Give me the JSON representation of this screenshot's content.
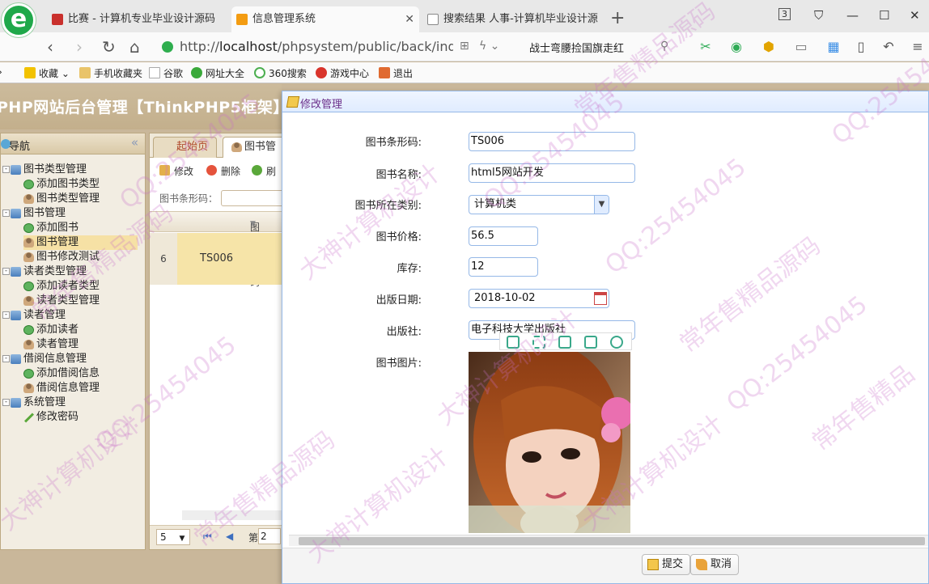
{
  "browser": {
    "tabs": [
      {
        "title": "比赛 - 计算机专业毕业设计源码",
        "icon_color": "#c9302c"
      },
      {
        "title": "信息管理系统",
        "icon_color": "#f39c12"
      },
      {
        "title": "搜索结果 人事-计算机毕业设计源",
        "icon_color": "#888888"
      }
    ],
    "tab_count_badge": "3",
    "url_prefix": "http://",
    "url_host": "localhost",
    "url_path": "/phpsystem/public/back/index/i",
    "news_headline": "战士弯腰捡国旗走红",
    "bookmarks": [
      "收藏",
      "手机收藏夹",
      "谷歌",
      "网址大全",
      "360搜索",
      "游戏中心",
      "退出"
    ]
  },
  "app": {
    "title": "PHP网站后台管理【ThinkPHP5框架】"
  },
  "nav": {
    "title": "导航",
    "tree": [
      {
        "label": "图书类型管理",
        "kind": "parent"
      },
      {
        "label": "添加图书类型",
        "kind": "add"
      },
      {
        "label": "图书类型管理",
        "kind": "user"
      },
      {
        "label": "图书管理",
        "kind": "parent"
      },
      {
        "label": "添加图书",
        "kind": "add"
      },
      {
        "label": "图书管理",
        "kind": "user",
        "selected": true
      },
      {
        "label": "图书修改测试",
        "kind": "user"
      },
      {
        "label": "读者类型管理",
        "kind": "parent"
      },
      {
        "label": "添加读者类型",
        "kind": "add"
      },
      {
        "label": "读者类型管理",
        "kind": "user"
      },
      {
        "label": "读者管理",
        "kind": "parent"
      },
      {
        "label": "添加读者",
        "kind": "add"
      },
      {
        "label": "读者管理",
        "kind": "user"
      },
      {
        "label": "借阅信息管理",
        "kind": "parent"
      },
      {
        "label": "添加借阅信息",
        "kind": "add"
      },
      {
        "label": "借阅信息管理",
        "kind": "user"
      },
      {
        "label": "系统管理",
        "kind": "parent"
      },
      {
        "label": "修改密码",
        "kind": "pen"
      }
    ]
  },
  "center": {
    "tabs": [
      "起始页",
      "图书管"
    ],
    "toolbar": {
      "edit": "修改",
      "delete": "删除",
      "refresh": "刷"
    },
    "search_label": "图书条形码：",
    "column_header": "图书条形码",
    "row": {
      "num": "6",
      "barcode": "TS006"
    },
    "pager": {
      "page_size": "5",
      "page_word": "第",
      "page_num": "2"
    }
  },
  "dialog": {
    "title": "修改管理",
    "fields": {
      "barcode_label": "图书条形码:",
      "barcode": "TS006",
      "name_label": "图书名称:",
      "name": "html5网站开发",
      "category_label": "图书所在类别:",
      "category": "计算机类",
      "price_label": "图书价格:",
      "price": "56.5",
      "stock_label": "库存:",
      "stock": "12",
      "date_label": "出版日期:",
      "date": "2018-10-02",
      "publisher_label": "出版社:",
      "publisher": "电子科技大学出版社",
      "image_label": "图书图片:"
    },
    "submit": "提交",
    "cancel": "取消"
  },
  "watermarks": [
    "QQ:25454045",
    "常年售精品源码",
    "大神计算机设计",
    "QQ:25454045",
    "大神计算机设计",
    "常年售精品源码",
    "QQ:25454045",
    "常年售精品源码",
    "大神计算机设计",
    "QQ:25454045",
    "大神计算机设计",
    "常年售精品源码",
    "QQ:25454045",
    "常年售精品",
    "大神计算机设计",
    "QQ:25454045"
  ]
}
